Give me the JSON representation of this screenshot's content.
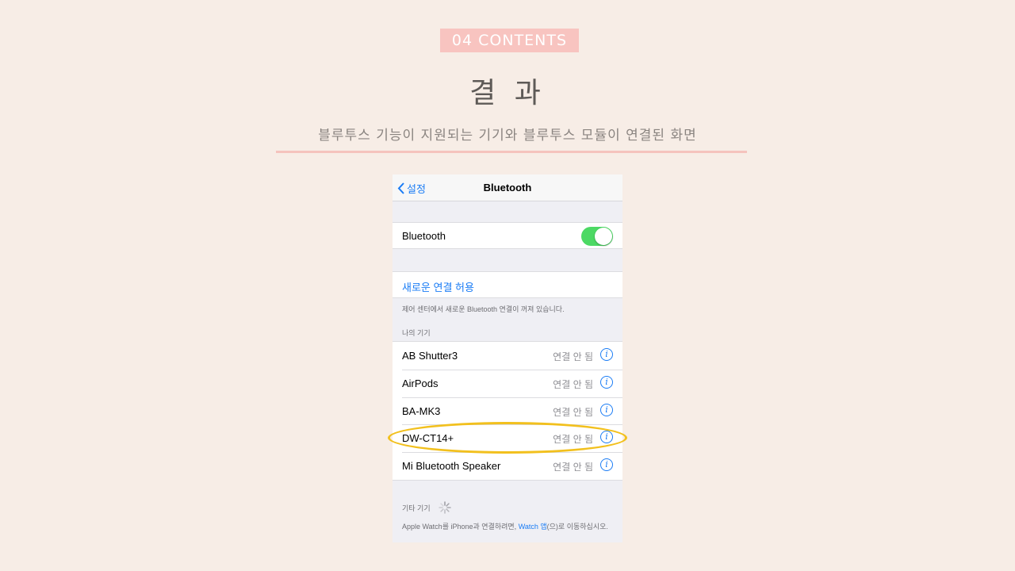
{
  "slide": {
    "tag": "04 CONTENTS",
    "title": "결 과",
    "subtitle": "블루투스 기능이 지원되는 기기와 블루투스 모듈이 연결된 화면"
  },
  "screen": {
    "back_label": "설정",
    "nav_title": "Bluetooth",
    "bluetooth_label": "Bluetooth",
    "bluetooth_on": true,
    "allow_new": "새로운 연결 허용",
    "control_center_note": "제어 센터에서 새로운 Bluetooth 연결이 꺼져 있습니다.",
    "my_devices_header": "나의 기기",
    "devices": [
      {
        "name": "AB Shutter3",
        "status": "연결 안 됨",
        "highlighted": false
      },
      {
        "name": "AirPods",
        "status": "연결 안 됨",
        "highlighted": false
      },
      {
        "name": "BA-MK3",
        "status": "연결 안 됨",
        "highlighted": false
      },
      {
        "name": "DW-CT14+",
        "status": "연결 안 됨",
        "highlighted": true
      },
      {
        "name": "Mi Bluetooth Speaker",
        "status": "연결 안 됨",
        "highlighted": false
      }
    ],
    "other_devices_header": "기타 기기",
    "watch_note_prefix": "Apple Watch를 iPhone과 연결하려면, ",
    "watch_note_link": "Watch 앱",
    "watch_note_suffix": "(으)로 이동하십시오.",
    "info_glyph": "i"
  },
  "colors": {
    "background": "#f7ede6",
    "tag_bg": "#f8c4c0",
    "rule": "#f5c3bd",
    "ios_blue": "#1a7cf5",
    "toggle_green": "#4cd964",
    "highlight": "#f2c01d"
  },
  "icons": {
    "back": "chevron-left-icon",
    "info": "info-circle-icon",
    "loading": "spinner-icon"
  }
}
